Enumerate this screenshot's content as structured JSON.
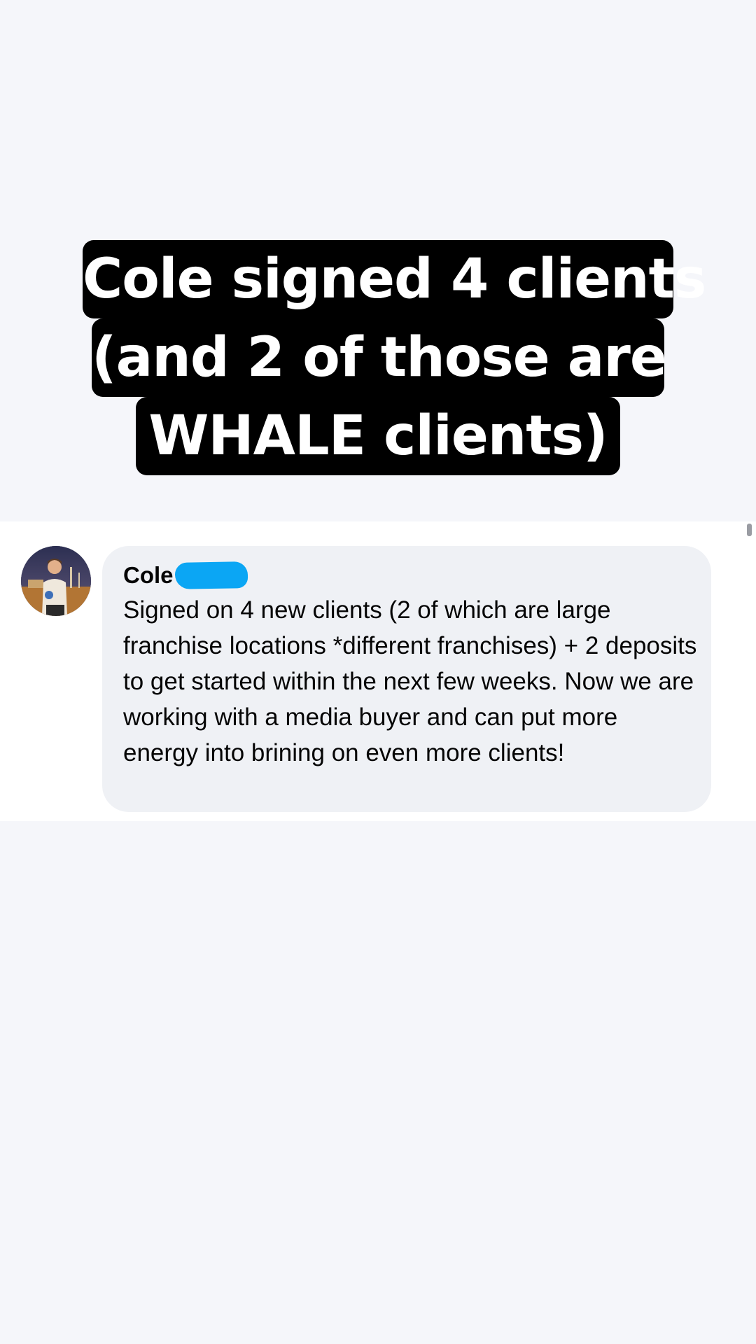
{
  "headline": {
    "lines": [
      "Cole signed 4 clients",
      "(and 2 of those are",
      "WHALE clients)"
    ]
  },
  "comment": {
    "author": "Cole",
    "text": "Signed on 4 new clients (2 of which are large franchise locations *different franchises) + 2 deposits to get started within the next few weeks. Now we are working with a media buyer and can put more energy into brining on even more clients!",
    "redaction_color": "#0ba6f4",
    "bubble_color": "#eff1f5"
  },
  "icons": {
    "avatar": "profile-photo"
  }
}
